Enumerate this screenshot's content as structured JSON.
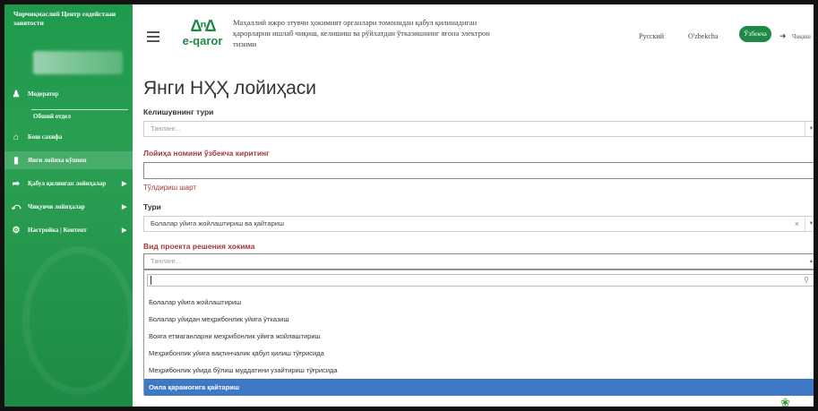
{
  "sidebar": {
    "title": "Чирчиқмаслий Центр содейстааи занятости",
    "profile_sub": "Модератор",
    "profile_sub2": "Обший отдел",
    "items": [
      {
        "label": "Бош сахифа",
        "icon": "home-icon"
      },
      {
        "label": "Янги лойиха кўшиш",
        "icon": "document-icon"
      },
      {
        "label": "Қабул қилинган лойиҳалар",
        "icon": "share-icon"
      },
      {
        "label": "Чиқувчи лойиҳалар",
        "icon": "reply-icon"
      },
      {
        "label": "Настройка | Контент",
        "icon": "gear-icon"
      }
    ]
  },
  "header": {
    "logo_text": "e-qaror",
    "description": "Маҳаллий ижро этувчи ҳокимият органлари томонидан қабул қилинадиган қарорларни ишлаб чиқиш, келишиш ва рўйхатдан ўтказишнинг ягона электрон тизими",
    "languages": [
      "Русский",
      "O'zbekcha"
    ],
    "active_language": "Ўзбекча",
    "logout_label": "Чиқиш"
  },
  "form": {
    "title": "Янги НҲҲ лойиҳаси",
    "agreement_type_label": "Келишувнинг тури",
    "agreement_type_placeholder": "Танланг...",
    "project_name_label": "Лойиҳа номини ўзбекча киритинг",
    "project_name_value": "",
    "fill_condition_link": "Тўлдириш шарт",
    "type_label": "Тури",
    "type_value": "Болалар уйига жойлаштириш ва қайтариш",
    "decision_type_label": "Вид проекта решения хокима",
    "decision_type_placeholder": "Танланг...",
    "dropdown_options": [
      "Болалар уйига жойлаштириш",
      "Болалар уйидан меҳрибонлик уйига ўтказиш",
      "Вояга етмаганларни меҳрибонлик уйига жойлаштириш",
      "Меҳрибонлик уйига вақтинчалик қабул қилиш тўғрисида",
      "Меҳрибонлик уйида бўлиш муддатини узайтириш тўғрисида",
      "Оила қарамоғига қайтариш"
    ],
    "selected_option": "Оила қарамоғига қайтариш"
  },
  "colors": {
    "brand": "#1d8a45",
    "highlight": "#3f79c5",
    "required": "#a23a3a"
  }
}
